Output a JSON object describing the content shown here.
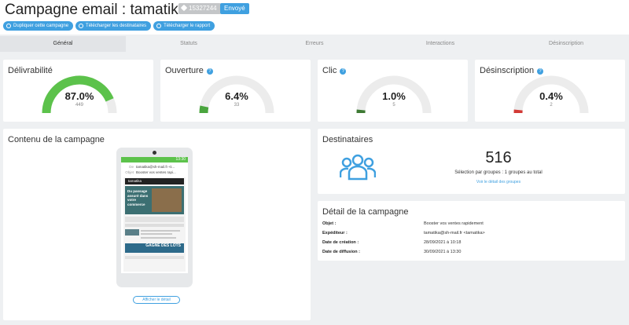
{
  "header": {
    "title": "Campagne email : tamatika.fr",
    "campaign_id": "15327244",
    "status": "Envoyé",
    "status_color": "#3fa0e0"
  },
  "actions": [
    {
      "label": "Dupliquer cette campagne",
      "icon": "duplicate-icon"
    },
    {
      "label": "Télécharger les destinataires",
      "icon": "download-icon"
    },
    {
      "label": "Télécharger le rapport",
      "icon": "download-icon"
    }
  ],
  "tabs": [
    {
      "label": "Général",
      "active": true
    },
    {
      "label": "Statuts",
      "active": false
    },
    {
      "label": "Erreurs",
      "active": false
    },
    {
      "label": "Interactions",
      "active": false
    },
    {
      "label": "Désinscription",
      "active": false
    }
  ],
  "stats": [
    {
      "title": "Délivrabilité",
      "value": "87.0%",
      "count": "449",
      "fraction": 0.87,
      "color": "#5cc24b",
      "help": false
    },
    {
      "title": "Ouverture",
      "value": "6.4%",
      "count": "33",
      "fraction": 0.064,
      "color": "#4aa53e",
      "help": true
    },
    {
      "title": "Clic",
      "value": "1.0%",
      "count": "5",
      "fraction": 0.01,
      "color": "#3e7a34",
      "help": true
    },
    {
      "title": "Désinscription",
      "value": "0.4%",
      "count": "2",
      "fraction": 0.004,
      "color": "#d33a36",
      "help": true
    }
  ],
  "content": {
    "title": "Contenu de la campagne",
    "phone_time": "13:30",
    "mail_from_label": "De",
    "mail_from": "tamatika@sh-mail.fr <t...",
    "mail_subject_label": "Objet",
    "mail_subject": "Booster vos ventes rapi...",
    "brand": "tamatika",
    "hero_text": "Du passage assuré dans votre commerce",
    "promo_text": "GAGNE DES LOTS",
    "show_button": "Afficher le détail"
  },
  "recipients": {
    "title": "Destinataires",
    "count": "516",
    "subtitle": "Sélection par groupes : 1 groupes au total",
    "link": "Voir le détail des groupes"
  },
  "details": {
    "title": "Détail de la campagne",
    "rows": [
      {
        "label": "Objet :",
        "value": "Booster vos ventes rapidement"
      },
      {
        "label": "Expéditeur :",
        "value": "tamatika@sh-mail.fr <tamatika>"
      },
      {
        "label": "Date de création :",
        "value": "28/09/2021 à 10:18"
      },
      {
        "label": "Date de diffusion :",
        "value": "30/09/2021 à 13:30"
      }
    ]
  }
}
